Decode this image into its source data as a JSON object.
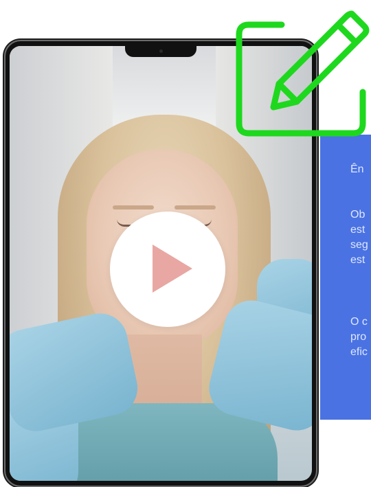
{
  "panel": {
    "paragraph_1": "Ên",
    "paragraph_2_lines": [
      "Ob",
      "est",
      "seg",
      "est"
    ],
    "paragraph_3_lines": [
      "O c",
      "pro",
      "efic"
    ]
  },
  "video": {
    "play_label": "Play"
  },
  "colors": {
    "panel_bg": "#4a72e2",
    "edit_icon": "#1ed81e",
    "play_triangle": "#e8a7a3"
  },
  "icons": {
    "edit": "pencil-square-icon",
    "play": "play-icon"
  }
}
